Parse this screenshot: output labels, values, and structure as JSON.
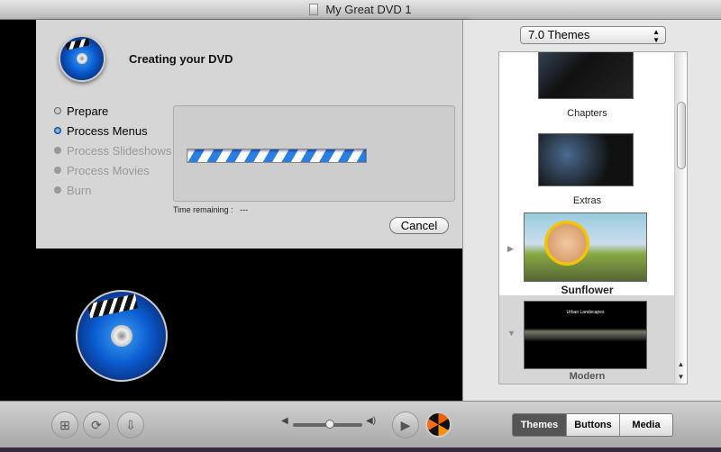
{
  "window": {
    "title": "My Great DVD 1"
  },
  "dialog": {
    "title": "Creating your DVD",
    "steps": [
      {
        "label": "Prepare",
        "state": "done"
      },
      {
        "label": "Process Menus",
        "state": "active"
      },
      {
        "label": "Process Slideshows",
        "state": "pending"
      },
      {
        "label": "Process Movies",
        "state": "pending"
      },
      {
        "label": "Burn",
        "state": "pending"
      }
    ],
    "time_label": "Time remaining :",
    "time_value": "---",
    "cancel_label": "Cancel",
    "progress": "indeterminate"
  },
  "themes": {
    "selector": "7.0 Themes",
    "items": [
      {
        "label": "Chapters"
      },
      {
        "label": "Extras"
      },
      {
        "label": "Sunflower"
      },
      {
        "label": "Modern",
        "thumb_title": "Urban Landscapes",
        "selected": true
      }
    ]
  },
  "toolbar": {
    "tabs": [
      {
        "label": "Themes",
        "selected": true
      },
      {
        "label": "Buttons"
      },
      {
        "label": "Media"
      }
    ],
    "icons": [
      "map-icon",
      "loop-icon",
      "dropzone-icon",
      "volume-low-icon",
      "volume-high-icon",
      "play-icon",
      "burn-icon"
    ]
  },
  "colors": {
    "accent": "#2b7fe0",
    "selected_tab": "#555555"
  }
}
